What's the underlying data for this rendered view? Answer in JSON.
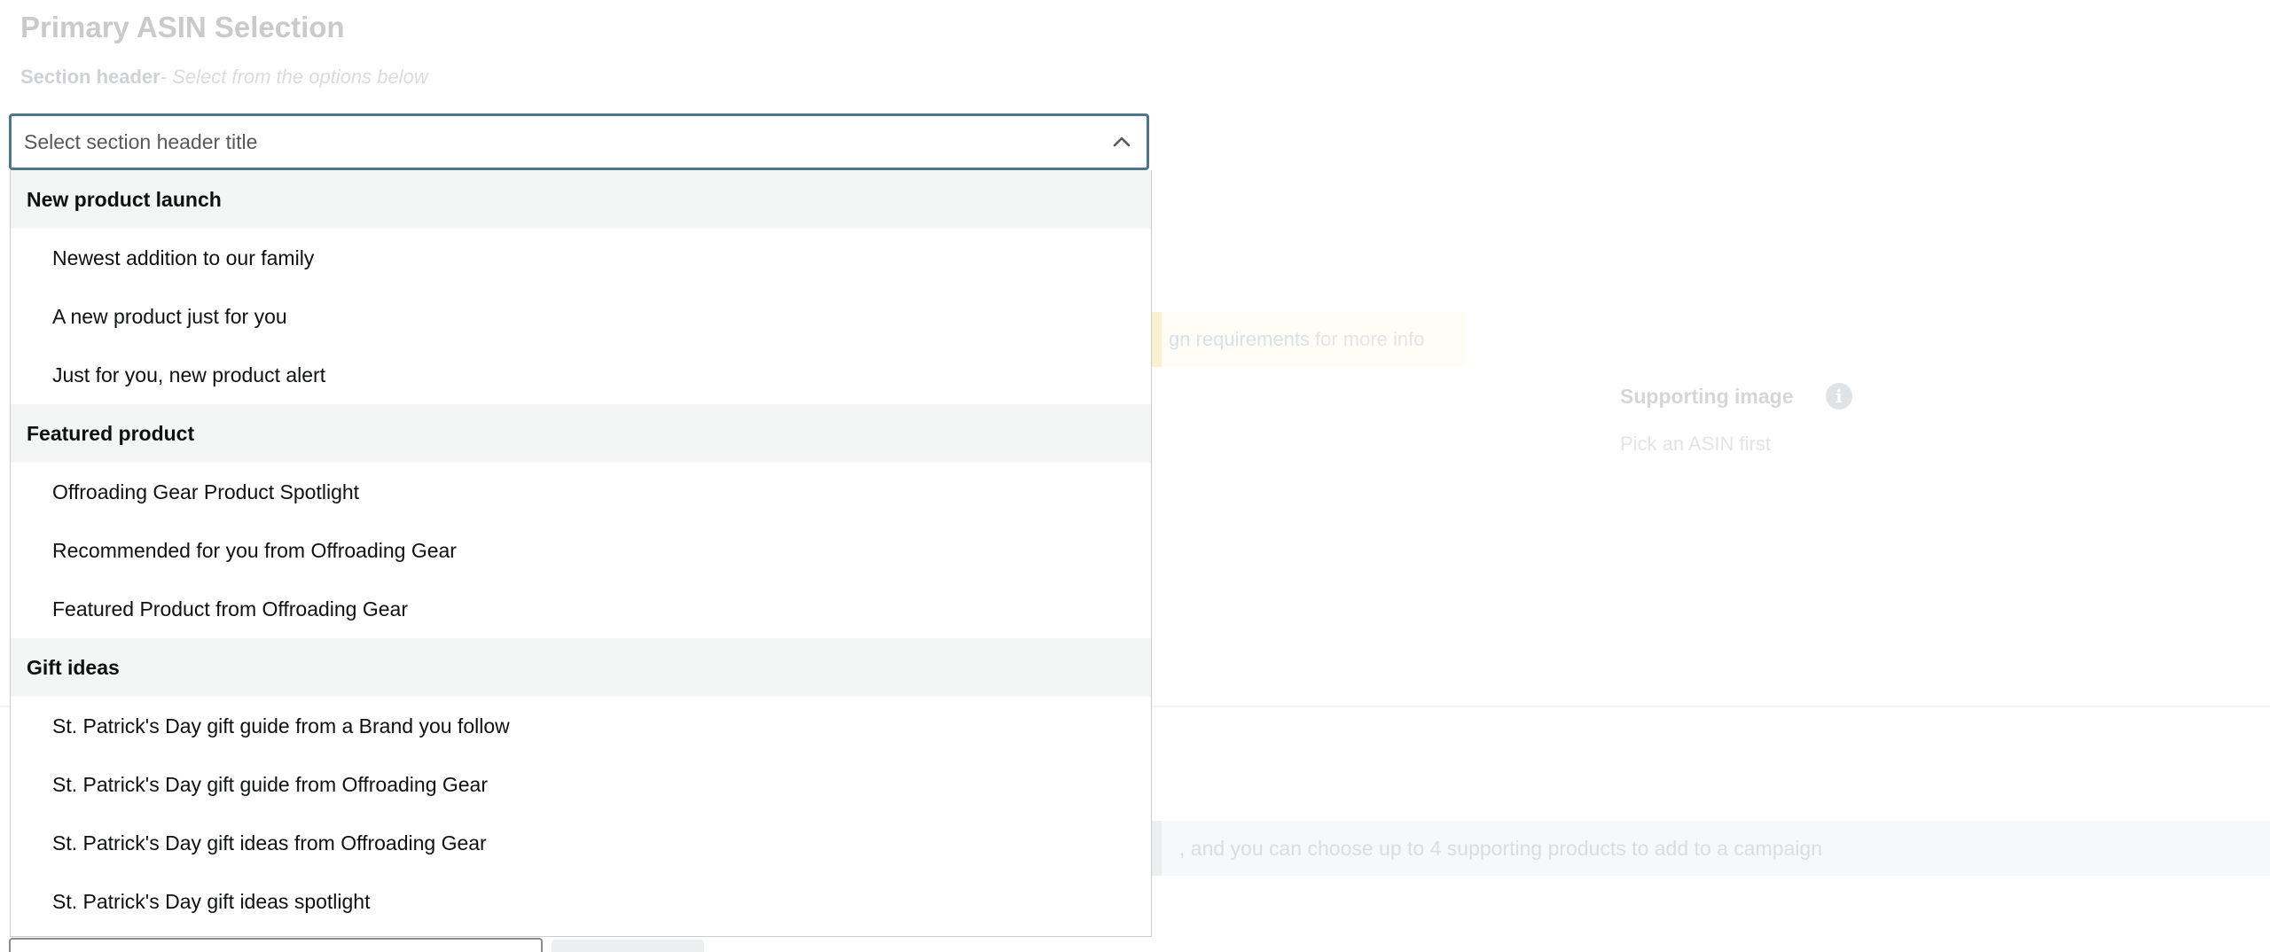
{
  "page": {
    "title": "Primary ASIN Selection",
    "section_header_label": "Section header",
    "section_header_hint": "- Select from the options below"
  },
  "background": {
    "banner_link": "gn requirements",
    "banner_rest": "for more info",
    "supporting_image_title": "Supporting image",
    "supporting_image_sub": "Pick an ASIN first",
    "info_strip_text": ", and you can choose up to 4 supporting products to add to a campaign"
  },
  "select": {
    "placeholder": "Select section header title",
    "expanded": true
  },
  "dropdown": {
    "groups": [
      {
        "label": "New product launch",
        "options": [
          "Newest addition to our family",
          "A new product just for you",
          "Just for you, new product alert"
        ]
      },
      {
        "label": "Featured product",
        "options": [
          "Offroading Gear Product Spotlight",
          "Recommended for you from Offroading Gear",
          "Featured Product from Offroading Gear"
        ]
      },
      {
        "label": "Gift ideas",
        "options": [
          "St. Patrick's Day gift guide from a Brand you follow",
          "St. Patrick's Day gift guide from Offroading Gear",
          "St. Patrick's Day gift ideas from Offroading Gear",
          "St. Patrick's Day gift ideas spotlight"
        ]
      }
    ]
  },
  "colors": {
    "focus_border": "#4d7689",
    "group_header_bg": "#f4f5f5",
    "text": "#0f1111"
  },
  "icons": {
    "chevron": "chevron-up-icon",
    "info": "info-icon"
  }
}
